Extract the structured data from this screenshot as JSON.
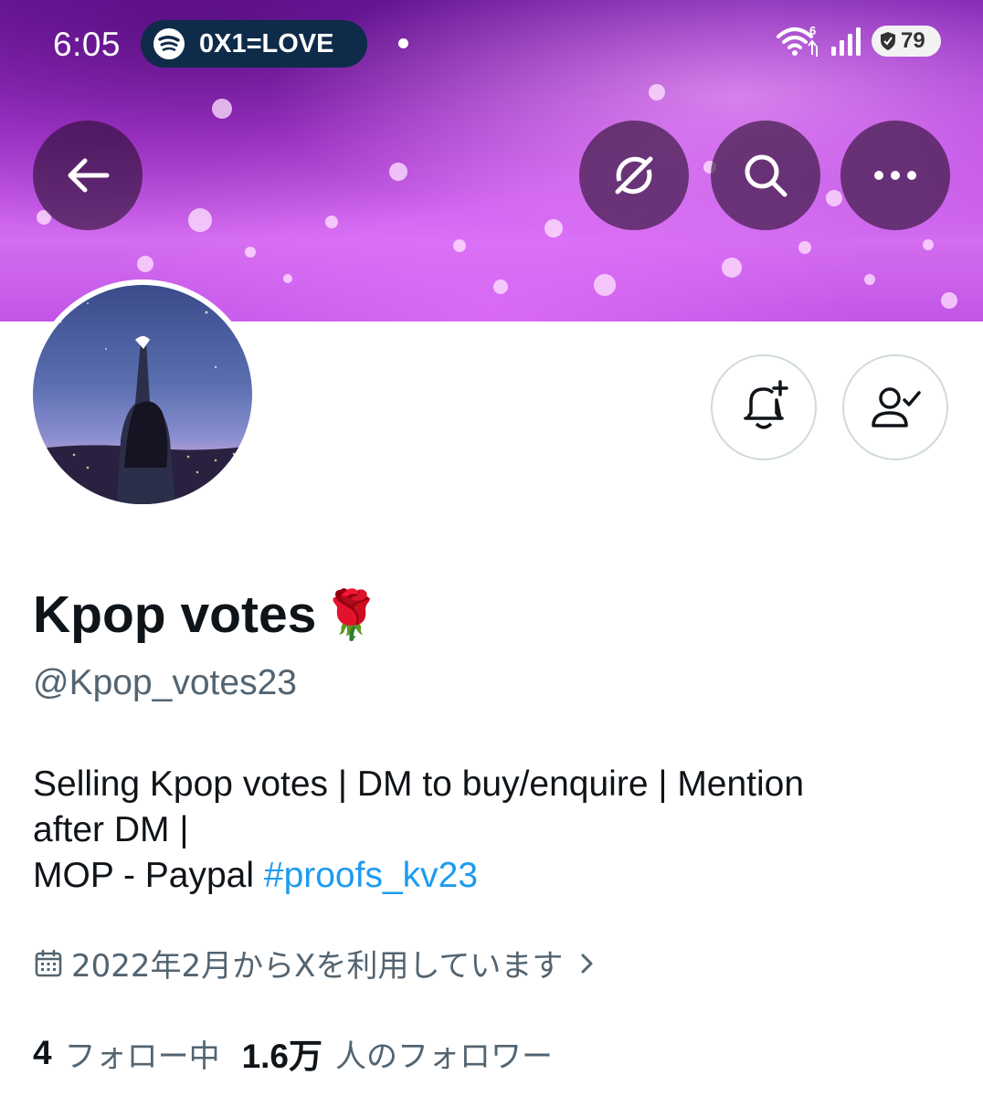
{
  "status_bar": {
    "time": "6:05",
    "now_playing": "0X1=LOVE",
    "battery": "79"
  },
  "banner": {
    "colors": {
      "top": "#7a1fb0",
      "mid": "#b43de0",
      "bottom": "#d36cf0"
    }
  },
  "nav": {
    "back_icon": "arrow-left-icon",
    "grok_icon": "grok-icon",
    "search_icon": "search-icon",
    "more_icon": "more-horizontal-icon"
  },
  "actions": {
    "notify_icon": "bell-plus-icon",
    "following_icon": "user-check-icon"
  },
  "profile": {
    "display_name": "Kpop votes",
    "name_emoji": "🌹",
    "handle": "@Kpop_votes23",
    "bio_line1": "Selling Kpop votes | DM to buy/enquire | Mention",
    "bio_line2": "after DM |",
    "bio_line3_text": "MOP - Paypal ",
    "bio_hashtag": "#proofs_kv23",
    "joined": "2022年2月からXを利用しています",
    "following_count": "4",
    "following_label": "フォロー中",
    "followers_count": "1.6万",
    "followers_label": "人のフォロワー"
  },
  "colors": {
    "link": "#1d9bf0",
    "secondary_text": "#536471",
    "primary_text": "#0f1419"
  }
}
